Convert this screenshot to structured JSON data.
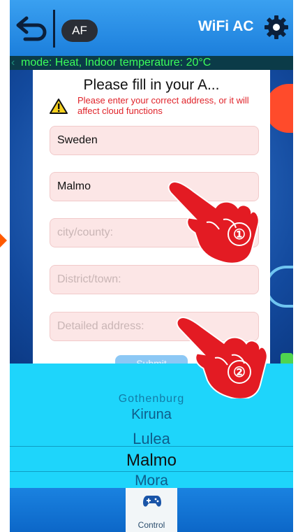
{
  "header": {
    "af_label": "AF",
    "title": "WiFi AC"
  },
  "status_bar": {
    "text": "mode: Heat,  Indoor temperature: 20°C"
  },
  "dialog": {
    "title": "Please fill in your A...",
    "warning": "Please enter your correct address, or it will affect cloud functions",
    "fields": [
      {
        "value": "Sweden",
        "placeholder": ""
      },
      {
        "value": "Malmo",
        "placeholder": ""
      },
      {
        "value": "",
        "placeholder": "city/county:"
      },
      {
        "value": "",
        "placeholder": "District/town:"
      },
      {
        "value": "",
        "placeholder": "Detailed address:"
      }
    ],
    "submit_label": "Submit"
  },
  "picker": {
    "items": [
      "Gothenburg",
      "Kiruna",
      "Lulea",
      "Malmo",
      "Mora"
    ],
    "selected": "Malmo"
  },
  "bottom_nav": {
    "control_label": "Control"
  },
  "annotations": {
    "step1": "①",
    "step2": "②"
  },
  "colors": {
    "header": "#1c7fdc",
    "ticker_text": "#3cff5a",
    "picker_bg": "#1ed5fb",
    "field_bg": "#fce6e6",
    "warning_text": "#e0232a",
    "hand": "#e31b23"
  }
}
